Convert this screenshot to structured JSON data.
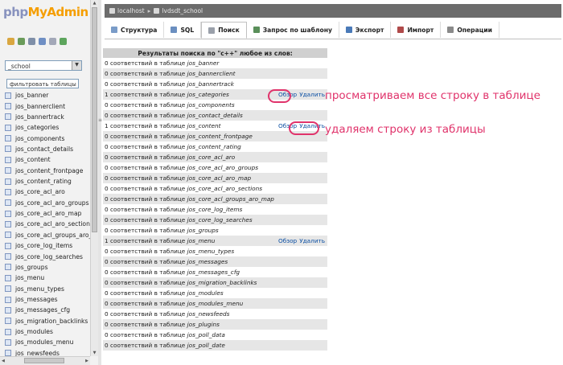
{
  "logo": {
    "part1": "php",
    "part2": "My",
    "part3": "Admin"
  },
  "sidebar": {
    "db_selected": "_school",
    "filter_text": "фильтровать таблицы г",
    "tables": [
      "jos_banner",
      "jos_bannerclient",
      "jos_bannertrack",
      "jos_categories",
      "jos_components",
      "jos_contact_details",
      "jos_content",
      "jos_content_frontpage",
      "jos_content_rating",
      "jos_core_acl_aro",
      "jos_core_acl_aro_groups",
      "jos_core_acl_aro_map",
      "jos_core_acl_aro_section",
      "jos_core_acl_groups_aro_",
      "jos_core_log_items",
      "jos_core_log_searches",
      "jos_groups",
      "jos_menu",
      "jos_menu_types",
      "jos_messages",
      "jos_messages_cfg",
      "jos_migration_backlinks",
      "jos_modules",
      "jos_modules_menu",
      "jos_newsfeeds"
    ]
  },
  "breadcrumb": {
    "server": "localhost",
    "database": "lvdsdt_school"
  },
  "tabs": [
    {
      "label": "Структура",
      "icon": "structure-icon",
      "color": "#7a9cc8"
    },
    {
      "label": "SQL",
      "icon": "sql-icon",
      "color": "#6b8fc0"
    },
    {
      "label": "Поиск",
      "icon": "search-icon",
      "color": "#9aa0aa"
    },
    {
      "label": "Запрос по шаблону",
      "icon": "query-icon",
      "color": "#5a8f5a"
    },
    {
      "label": "Экспорт",
      "icon": "export-icon",
      "color": "#4a7ab8"
    },
    {
      "label": "Импорт",
      "icon": "import-icon",
      "color": "#b04a4a"
    },
    {
      "label": "Операции",
      "icon": "operations-icon",
      "color": "#8a8a8a"
    }
  ],
  "results": {
    "header": "Результаты поиска по \"с++\" любое из слов:",
    "matches_suffix": "соответствий в таблице",
    "browse_label": "Обзор",
    "delete_label": "Удалить",
    "rows": [
      {
        "count": "0",
        "table": "jos_banner"
      },
      {
        "count": "0",
        "table": "jos_bannerclient"
      },
      {
        "count": "0",
        "table": "jos_bannertrack"
      },
      {
        "count": "1",
        "table": "jos_categories",
        "actions": true
      },
      {
        "count": "0",
        "table": "jos_components"
      },
      {
        "count": "0",
        "table": "jos_contact_details"
      },
      {
        "count": "1",
        "table": "jos_content",
        "actions": true
      },
      {
        "count": "0",
        "table": "jos_content_frontpage"
      },
      {
        "count": "0",
        "table": "jos_content_rating"
      },
      {
        "count": "0",
        "table": "jos_core_acl_aro"
      },
      {
        "count": "0",
        "table": "jos_core_acl_aro_groups"
      },
      {
        "count": "0",
        "table": "jos_core_acl_aro_map"
      },
      {
        "count": "0",
        "table": "jos_core_acl_aro_sections"
      },
      {
        "count": "0",
        "table": "jos_core_acl_groups_aro_map"
      },
      {
        "count": "0",
        "table": "jos_core_log_items"
      },
      {
        "count": "0",
        "table": "jos_core_log_searches"
      },
      {
        "count": "0",
        "table": "jos_groups"
      },
      {
        "count": "1",
        "table": "jos_menu",
        "actions": true
      },
      {
        "count": "0",
        "table": "jos_menu_types"
      },
      {
        "count": "0",
        "table": "jos_messages"
      },
      {
        "count": "0",
        "table": "jos_messages_cfg"
      },
      {
        "count": "0",
        "table": "jos_migration_backlinks"
      },
      {
        "count": "0",
        "table": "jos_modules"
      },
      {
        "count": "0",
        "table": "jos_modules_menu"
      },
      {
        "count": "0",
        "table": "jos_newsfeeds"
      },
      {
        "count": "0",
        "table": "jos_plugins"
      },
      {
        "count": "0",
        "table": "jos_poll_data"
      },
      {
        "count": "0",
        "table": "jos_poll_date"
      }
    ]
  },
  "annotations": {
    "browse_note": "просматриваем все строку в таблице",
    "delete_note": "удаляем строку из таблицы",
    "color": "#e0336b"
  }
}
